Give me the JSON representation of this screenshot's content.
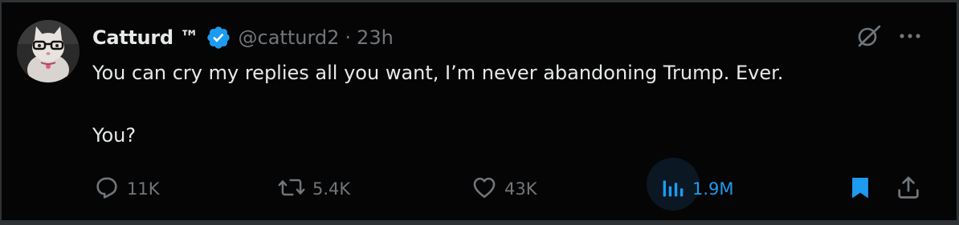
{
  "tweet": {
    "display_name": "Catturd ™",
    "handle": "@catturd2",
    "separator": "·",
    "time": "23h",
    "text_line1": "You can cry my replies all you want, I’m never abandoning Trump. Ever.",
    "text_line2": "You?"
  },
  "actions": {
    "replies": "11K",
    "reposts": "5.4K",
    "likes": "43K",
    "views": "1.9M"
  },
  "icons": {
    "verified": "verified-badge-icon",
    "grok": "grok-icon",
    "more": "more-icon",
    "reply": "reply-icon",
    "repost": "repost-icon",
    "like": "heart-icon",
    "views": "analytics-icon",
    "bookmark": "bookmark-icon",
    "share": "share-icon"
  },
  "colors": {
    "background": "#000000",
    "text": "#e7e9ea",
    "muted": "#71767b",
    "accent": "#1d9bf0"
  }
}
